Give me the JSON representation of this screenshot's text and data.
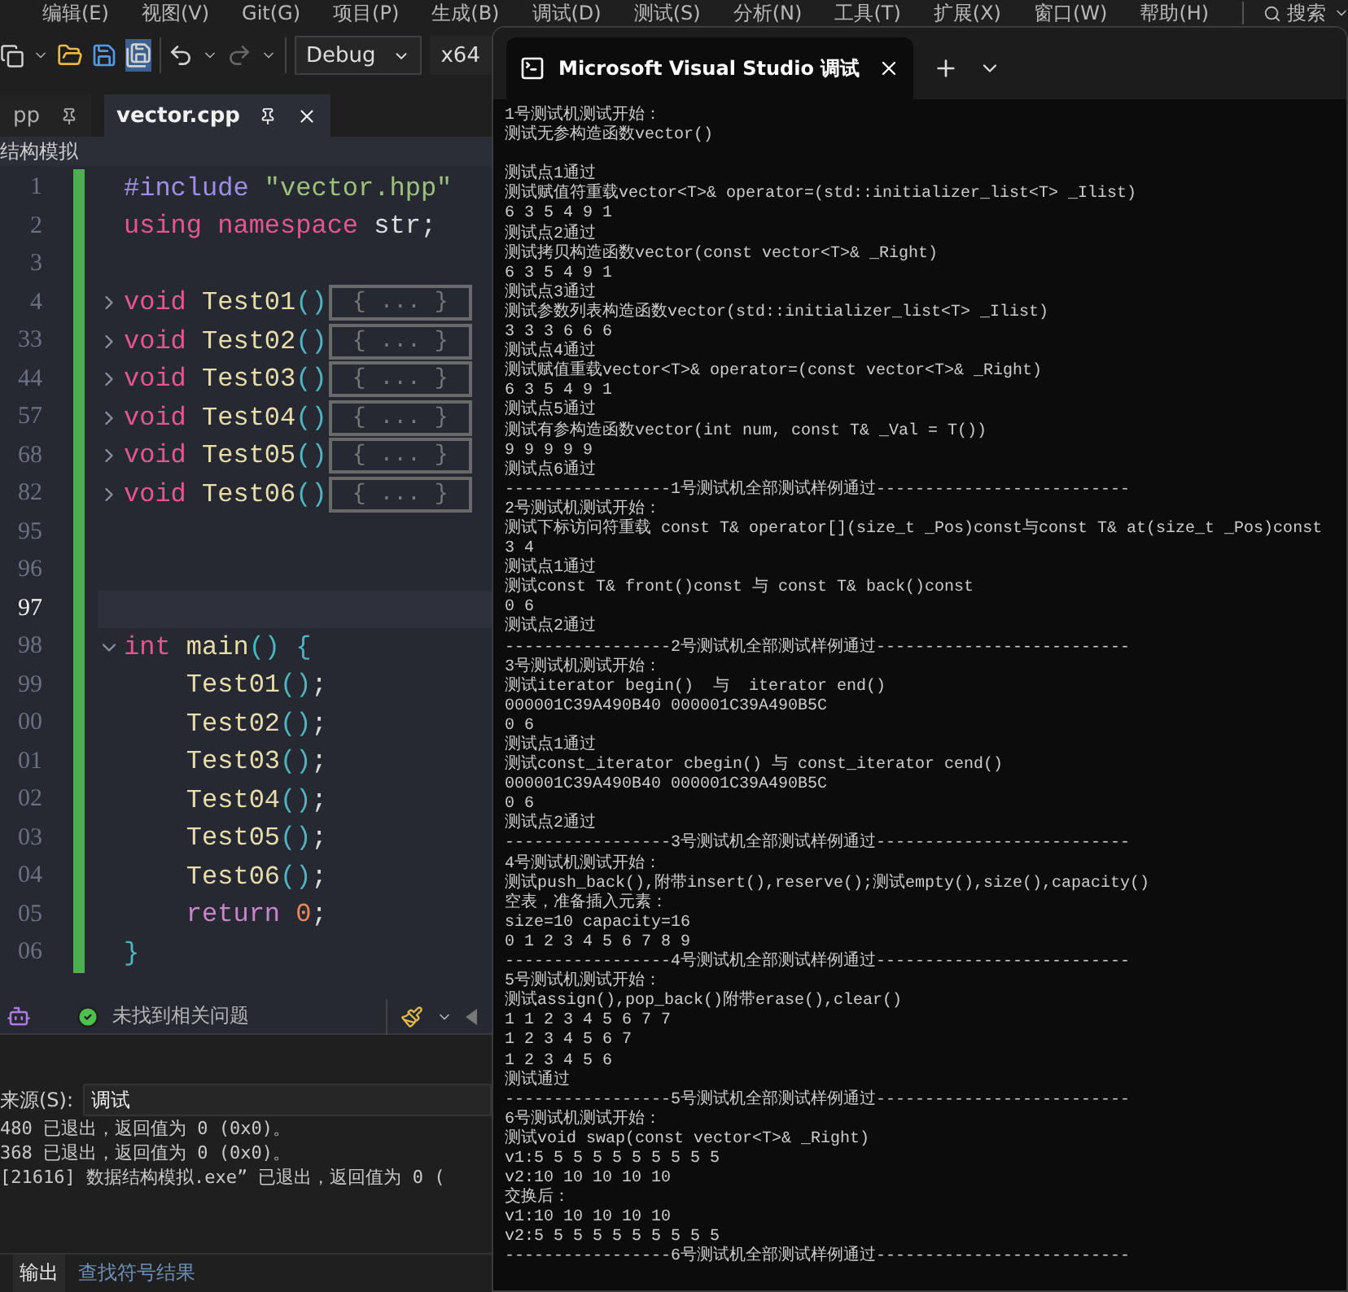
{
  "menu": [
    {
      "label": "编辑(E)"
    },
    {
      "label": "视图(V)"
    },
    {
      "label": "Git(G)"
    },
    {
      "label": "项目(P)"
    },
    {
      "label": "生成(B)"
    },
    {
      "label": "调试(D)"
    },
    {
      "label": "测试(S)"
    },
    {
      "label": "分析(N)"
    },
    {
      "label": "工具(T)"
    },
    {
      "label": "扩展(X)"
    },
    {
      "label": "窗口(W)"
    },
    {
      "label": "帮助(H)"
    }
  ],
  "search": {
    "label": "搜索"
  },
  "toolbar": {
    "configuration": "Debug",
    "platform": "x64"
  },
  "tabs": [
    {
      "label": "pp",
      "selected": false
    },
    {
      "label": "vector.cpp",
      "selected": true
    }
  ],
  "navigation_bar": {
    "scope": "结构模拟"
  },
  "editor": {
    "lines": [
      {
        "number": "1",
        "current": false,
        "tokens": [
          {
            "kind": "preproc",
            "text": "#include "
          },
          {
            "kind": "string",
            "text": "\"vector.hpp\""
          }
        ]
      },
      {
        "number": "2",
        "current": false,
        "tokens": [
          {
            "kind": "keyword",
            "text": "using namespace "
          },
          {
            "kind": "plain",
            "text": "str;"
          }
        ]
      },
      {
        "number": "3",
        "current": false
      },
      {
        "number": "4",
        "current": false,
        "kind": "fold",
        "expanded": false,
        "folded": "{ ... }",
        "tokens": [
          {
            "kind": "keyword",
            "text": "void "
          },
          {
            "kind": "func",
            "text": "Test01"
          },
          {
            "kind": "punct",
            "text": "()"
          }
        ]
      },
      {
        "number": "33",
        "current": false,
        "kind": "fold",
        "expanded": false,
        "folded": "{ ... }",
        "tokens": [
          {
            "kind": "keyword",
            "text": "void "
          },
          {
            "kind": "func",
            "text": "Test02"
          },
          {
            "kind": "punct",
            "text": "()"
          }
        ]
      },
      {
        "number": "44",
        "current": false,
        "kind": "fold",
        "expanded": false,
        "folded": "{ ... }",
        "tokens": [
          {
            "kind": "keyword",
            "text": "void "
          },
          {
            "kind": "func",
            "text": "Test03"
          },
          {
            "kind": "punct",
            "text": "()"
          }
        ]
      },
      {
        "number": "57",
        "current": false,
        "kind": "fold",
        "expanded": false,
        "folded": "{ ... }",
        "tokens": [
          {
            "kind": "keyword",
            "text": "void "
          },
          {
            "kind": "func",
            "text": "Test04"
          },
          {
            "kind": "punct",
            "text": "()"
          }
        ]
      },
      {
        "number": "68",
        "current": false,
        "kind": "fold",
        "expanded": false,
        "folded": "{ ... }",
        "tokens": [
          {
            "kind": "keyword",
            "text": "void "
          },
          {
            "kind": "func",
            "text": "Test05"
          },
          {
            "kind": "punct",
            "text": "()"
          }
        ]
      },
      {
        "number": "82",
        "current": false,
        "kind": "fold",
        "expanded": false,
        "folded": "{ ... }",
        "tokens": [
          {
            "kind": "keyword",
            "text": "void "
          },
          {
            "kind": "func",
            "text": "Test06"
          },
          {
            "kind": "punct",
            "text": "()"
          }
        ]
      },
      {
        "number": "95",
        "current": false
      },
      {
        "number": "96",
        "current": false
      },
      {
        "number": "97",
        "current": true
      },
      {
        "number": "98",
        "current": false,
        "kind": "fold",
        "expanded": true,
        "tokens": [
          {
            "kind": "keyword",
            "text": "int "
          },
          {
            "kind": "func",
            "text": "main"
          },
          {
            "kind": "punct",
            "text": "() {"
          }
        ]
      },
      {
        "number": "99",
        "current": false,
        "tokens": [
          {
            "kind": "func",
            "text": "    Test01"
          },
          {
            "kind": "punct",
            "text": "()"
          },
          {
            "kind": "plain",
            "text": ";"
          }
        ]
      },
      {
        "number": "00",
        "current": false,
        "tokens": [
          {
            "kind": "func",
            "text": "    Test02"
          },
          {
            "kind": "punct",
            "text": "()"
          },
          {
            "kind": "plain",
            "text": ";"
          }
        ]
      },
      {
        "number": "01",
        "current": false,
        "tokens": [
          {
            "kind": "func",
            "text": "    Test03"
          },
          {
            "kind": "punct",
            "text": "()"
          },
          {
            "kind": "plain",
            "text": ";"
          }
        ]
      },
      {
        "number": "02",
        "current": false,
        "tokens": [
          {
            "kind": "func",
            "text": "    Test04"
          },
          {
            "kind": "punct",
            "text": "()"
          },
          {
            "kind": "plain",
            "text": ";"
          }
        ]
      },
      {
        "number": "03",
        "current": false,
        "tokens": [
          {
            "kind": "func",
            "text": "    Test05"
          },
          {
            "kind": "punct",
            "text": "()"
          },
          {
            "kind": "plain",
            "text": ";"
          }
        ]
      },
      {
        "number": "04",
        "current": false,
        "tokens": [
          {
            "kind": "func",
            "text": "    Test06"
          },
          {
            "kind": "punct",
            "text": "()"
          },
          {
            "kind": "plain",
            "text": ";"
          }
        ]
      },
      {
        "number": "05",
        "current": false,
        "tokens": [
          {
            "kind": "control",
            "text": "    return "
          },
          {
            "kind": "number",
            "text": "0"
          },
          {
            "kind": "plain",
            "text": ";"
          }
        ]
      },
      {
        "number": "06",
        "current": false,
        "tokens": [
          {
            "kind": "punct",
            "text": "}"
          }
        ]
      }
    ]
  },
  "status": {
    "issues": "未找到相关问题"
  },
  "output": {
    "source_label": "来源(S):",
    "source": "调试",
    "lines": [
      "480 已退出，返回值为 0 (0x0)。",
      "368 已退出，返回值为 0 (0x0)。",
      "[21616] 数据结构模拟.exe” 已退出，返回值为 0 ("
    ],
    "tabs": [
      {
        "label": "输出",
        "selected": true
      },
      {
        "label": "查找符号结果",
        "selected": false
      }
    ]
  },
  "terminal": {
    "title": "Microsoft Visual Studio 调试",
    "lines": [
      {
        "kind": "text",
        "text": "1号测试机测试开始："
      },
      {
        "kind": "text",
        "text": "测试无参构造函数vector()"
      },
      {
        "kind": "blank"
      },
      {
        "kind": "text",
        "text": "测试点1通过"
      },
      {
        "kind": "text",
        "text": "测试赋值符重载vector<T>& operator=(std::initializer_list<T> _Ilist)"
      },
      {
        "kind": "text",
        "text": "6 3 5 4 9 1"
      },
      {
        "kind": "text",
        "text": "测试点2通过"
      },
      {
        "kind": "text",
        "text": "测试拷贝构造函数vector(const vector<T>& _Right)"
      },
      {
        "kind": "text",
        "text": "6 3 5 4 9 1"
      },
      {
        "kind": "text",
        "text": "测试点3通过"
      },
      {
        "kind": "text",
        "text": "测试参数列表构造函数vector(std::initializer_list<T> _Ilist)"
      },
      {
        "kind": "text",
        "text": "3 3 3 6 6 6"
      },
      {
        "kind": "text",
        "text": "测试点4通过"
      },
      {
        "kind": "text",
        "text": "测试赋值重载vector<T>& operator=(const vector<T>& _Right)"
      },
      {
        "kind": "text",
        "text": "6 3 5 4 9 1"
      },
      {
        "kind": "text",
        "text": "测试点5通过"
      },
      {
        "kind": "text",
        "text": "测试有参构造函数vector(int num, const T& _Val = T())"
      },
      {
        "kind": "text",
        "text": "9 9 9 9 9"
      },
      {
        "kind": "text",
        "text": "测试点6通过"
      },
      {
        "kind": "text",
        "text": "-----------------1号测试机全部测试样例通过--------------------------"
      },
      {
        "kind": "text",
        "text": "2号测试机测试开始："
      },
      {
        "kind": "text",
        "text": "测试下标访问符重载 const T& operator[](size_t _Pos)const与const T& at(size_t _Pos)const"
      },
      {
        "kind": "text",
        "text": "3 4"
      },
      {
        "kind": "text",
        "text": "测试点1通过"
      },
      {
        "kind": "text",
        "text": "测试const T& front()const 与 const T& back()const"
      },
      {
        "kind": "text",
        "text": "0 6"
      },
      {
        "kind": "text",
        "text": "测试点2通过"
      },
      {
        "kind": "text",
        "text": "-----------------2号测试机全部测试样例通过--------------------------"
      },
      {
        "kind": "text",
        "text": "3号测试机测试开始："
      },
      {
        "kind": "text",
        "text": "测试iterator begin()  与  iterator end()"
      },
      {
        "kind": "text",
        "text": "000001C39A490B40 000001C39A490B5C"
      },
      {
        "kind": "text",
        "text": "0 6"
      },
      {
        "kind": "text",
        "text": "测试点1通过"
      },
      {
        "kind": "text",
        "text": "测试const_iterator cbegin() 与 const_iterator cend()"
      },
      {
        "kind": "text",
        "text": "000001C39A490B40 000001C39A490B5C"
      },
      {
        "kind": "text",
        "text": "0 6"
      },
      {
        "kind": "text",
        "text": "测试点2通过"
      },
      {
        "kind": "text",
        "text": "-----------------3号测试机全部测试样例通过--------------------------"
      },
      {
        "kind": "text",
        "text": "4号测试机测试开始："
      },
      {
        "kind": "text",
        "text": "测试push_back(),附带insert(),reserve();测试empty(),size(),capacity()"
      },
      {
        "kind": "text",
        "text": "空表，准备插入元素："
      },
      {
        "kind": "text",
        "text": "size=10 capacity=16"
      },
      {
        "kind": "text",
        "text": "0 1 2 3 4 5 6 7 8 9"
      },
      {
        "kind": "text",
        "text": "-----------------4号测试机全部测试样例通过--------------------------"
      },
      {
        "kind": "text",
        "text": "5号测试机测试开始："
      },
      {
        "kind": "text",
        "text": "测试assign(),pop_back()附带erase(),clear()"
      },
      {
        "kind": "text",
        "text": "1 1 2 3 4 5 6 7 7"
      },
      {
        "kind": "text",
        "text": "1 2 3 4 5 6 7"
      },
      {
        "kind": "text",
        "text": "1 2 3 4 5 6"
      },
      {
        "kind": "text",
        "text": "测试通过"
      },
      {
        "kind": "text",
        "text": "-----------------5号测试机全部测试样例通过--------------------------"
      },
      {
        "kind": "text",
        "text": "6号测试机测试开始："
      },
      {
        "kind": "text",
        "text": "测试void swap(const vector<T>& _Right)"
      },
      {
        "kind": "text",
        "text": "v1:5 5 5 5 5 5 5 5 5 5"
      },
      {
        "kind": "text",
        "text": "v2:10 10 10 10 10"
      },
      {
        "kind": "text",
        "text": "交换后："
      },
      {
        "kind": "text",
        "text": "v1:10 10 10 10 10"
      },
      {
        "kind": "text",
        "text": "v2:5 5 5 5 5 5 5 5 5 5"
      },
      {
        "kind": "text",
        "text": "-----------------6号测试机全部测试样例通过--------------------------"
      }
    ]
  }
}
